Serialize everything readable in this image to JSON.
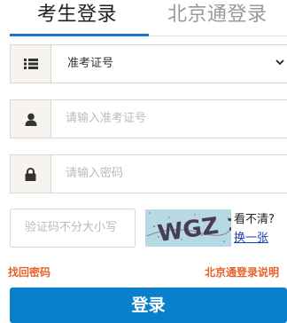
{
  "tabs": {
    "active": "考生登录",
    "inactive": "北京通登录"
  },
  "form": {
    "id_type": {
      "value": "准考证号",
      "icon": "list-icon"
    },
    "id_number": {
      "placeholder": "请输入准考证号",
      "icon": "user-icon"
    },
    "password": {
      "placeholder": "请输入密码",
      "icon": "lock-icon"
    },
    "captcha": {
      "placeholder": "验证码不分大小写",
      "image_text": "WGZ >",
      "unclear_label": "看不清?",
      "swap_label": "换一张"
    }
  },
  "links": {
    "forgot_password": "找回密码",
    "beijingtong_guide": "北京通登录说明"
  },
  "login_button": "登录",
  "colors": {
    "accent": "#1a73d6",
    "link_orange": "#e8602a",
    "button_blue": "#0a80cc"
  }
}
